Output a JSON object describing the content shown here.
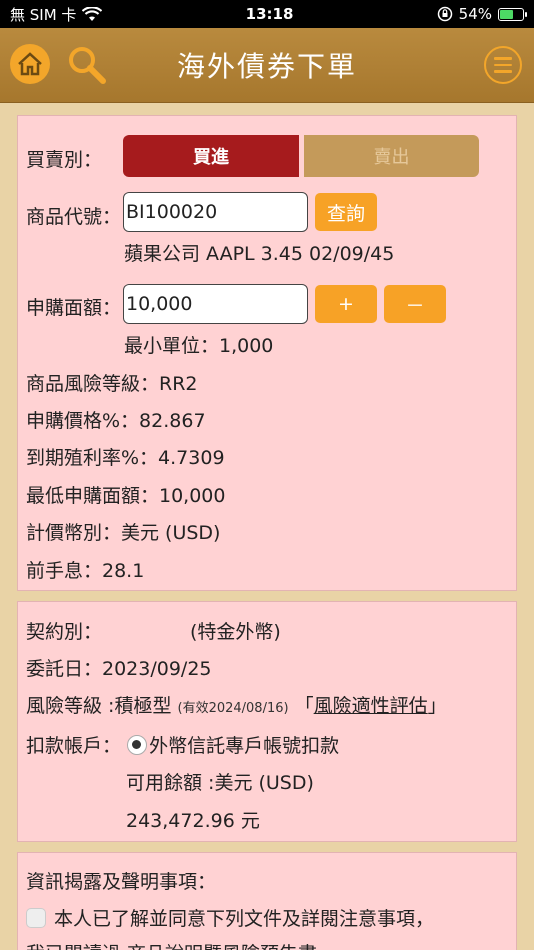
{
  "status": {
    "carrier": "無 SIM 卡",
    "time": "13:18",
    "battery": "54%"
  },
  "header": {
    "title": "海外債券下單"
  },
  "order": {
    "side_label": "買賣別：",
    "buy": "買進",
    "sell": "賣出",
    "code_label": "商品代號：",
    "code_value": "BI100020",
    "query": "查詢",
    "product_desc": "蘋果公司 AAPL 3.45 02/09/45",
    "amount_label": "申購面額：",
    "amount_value": "10,000",
    "plus": "+",
    "minus": "－",
    "min_unit": "最小單位：1,000",
    "risk_level": "商品風險等級：RR2",
    "price": "申購價格%：82.867",
    "ytm": "到期殖利率%：4.7309",
    "min_amount": "最低申購面額：10,000",
    "currency": "計價幣別：美元 (USD)",
    "accrued": "前手息：28.1"
  },
  "contract": {
    "type_label": "契約別：",
    "type_value": "(特金外幣)",
    "date": "委託日：2023/09/25",
    "risk_label": "風險等級 :積極型",
    "risk_valid": "(有效2024/08/16)",
    "risk_link_open": "「",
    "risk_link": "風險適性評估",
    "risk_link_close": "」",
    "debit_label": "扣款帳戶：",
    "debit_option": "外幣信託專戶帳號扣款",
    "balance_label": "可用餘額 :美元 (USD)",
    "balance_value": "243,472.96 元"
  },
  "disclosure": {
    "title": "資訊揭露及聲明事項：",
    "agree": "本人已了解並同意下列文件及詳閱注意事項，",
    "line2": "我已閱讀過 商品說明暨風險預告書"
  }
}
